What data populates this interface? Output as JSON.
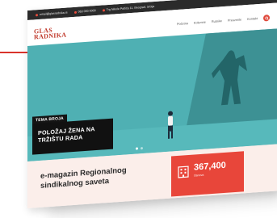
{
  "topbar": {
    "email": "email@glasradnika.rs",
    "phone": "063 000 0000",
    "address": "Trg Nikole Pašića 11, Beograd, Srbija"
  },
  "logo": {
    "line1": "GLAS",
    "line2": "RADNIKA"
  },
  "nav": {
    "items": [
      "Početna",
      "Kolumne",
      "Rubrike",
      "Preuzmite",
      "Kontakt"
    ],
    "search_icon": "search-icon"
  },
  "hero": {
    "tag": "TEMA BROJA",
    "caption_lines": [
      "POLOŽAJ ŽENA NA",
      "TRŽIŠTU RADA"
    ],
    "slides": 2,
    "active_slide": 1
  },
  "bottom": {
    "title_lines": [
      "e-magazin Regionalnog",
      "sindikalnog saveta"
    ],
    "stat_value": "367,400",
    "stat_label": "članova"
  },
  "colors": {
    "accent": "#e04a3c",
    "hero": "#4fb0b3",
    "dark": "#141414"
  }
}
